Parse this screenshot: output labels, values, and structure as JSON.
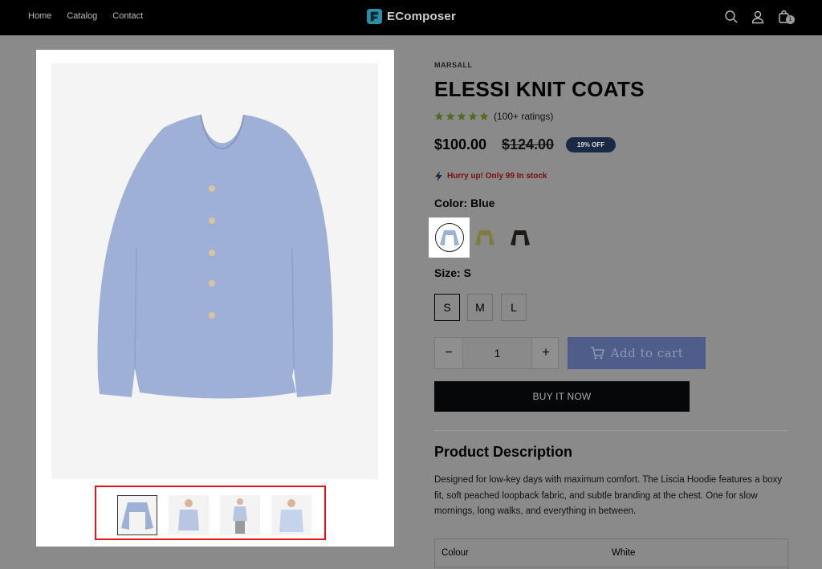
{
  "header": {
    "nav": [
      "Home",
      "Catalog",
      "Contact"
    ],
    "brand": "EComposer",
    "cart_count": "1"
  },
  "product": {
    "vendor": "MARSALL",
    "title": "ELESSI KNIT COATS",
    "rating": {
      "stars": 5,
      "text": "(100+ ratings)"
    },
    "price": "$100.00",
    "compare_price": "$124.00",
    "discount_badge": "19% OFF",
    "stock_message": "Hurry up! Only 99 In stock",
    "color_label": "Color:",
    "color_value": "Blue",
    "size_label": "Size:",
    "size_value": "S",
    "sizes": [
      "S",
      "M",
      "L"
    ],
    "quantity": "1",
    "add_to_cart": "Add to cart",
    "buy_now": "BUY IT NOW",
    "description_title": "Product Description",
    "description": "Designed for low-key days with maximum comfort. The Liscia Hoodie features a boxy fit, soft peached loopback fabric, and subtle branding at the chest. One for slow mornings, long walks, and everything in between.",
    "specs": [
      {
        "key": "Colour",
        "value": "White"
      }
    ]
  },
  "colors": {
    "swatches": [
      "blue",
      "yellow",
      "black"
    ],
    "accent": "#e0141a"
  },
  "icons": [
    "search-icon",
    "account-icon",
    "cart-icon",
    "lightning-icon",
    "star-icon",
    "shopping-cart-icon"
  ]
}
